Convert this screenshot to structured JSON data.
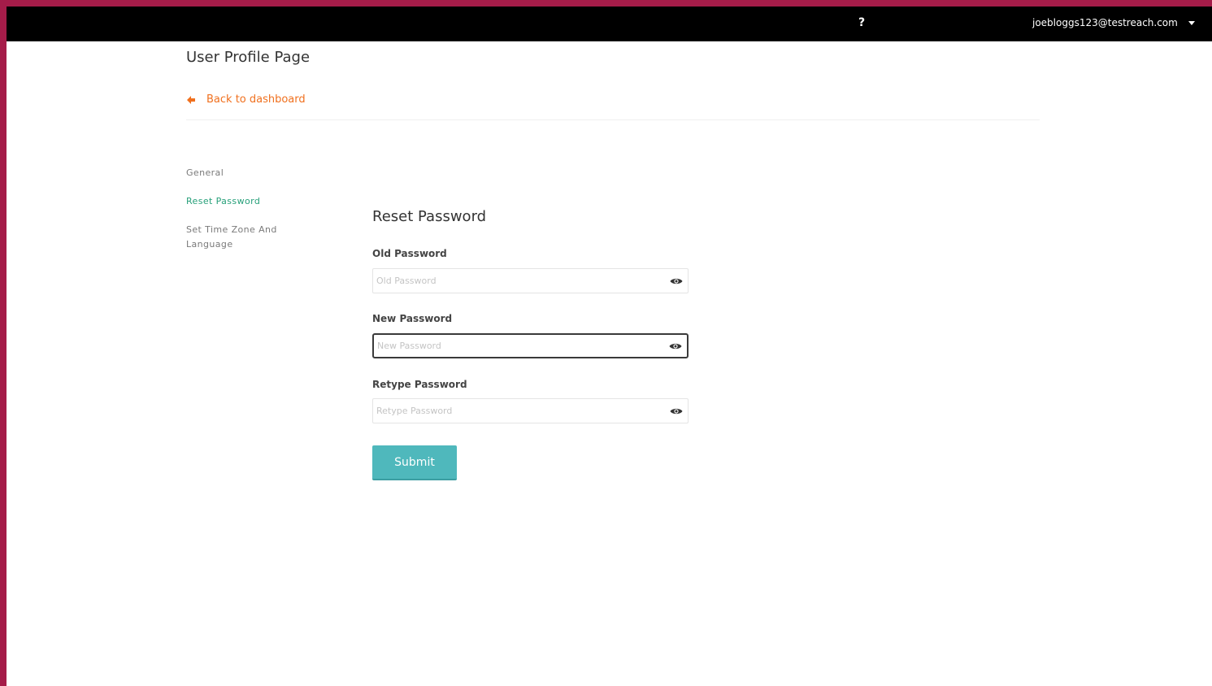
{
  "header": {
    "help_label": "?",
    "user_email": "joebloggs123@testreach.com"
  },
  "page": {
    "title": "User Profile Page",
    "back_label": "Back to dashboard"
  },
  "sidebar": {
    "items": [
      {
        "label": "General",
        "active": false
      },
      {
        "label": "Reset Password",
        "active": true
      },
      {
        "label": "Set Time Zone And Language",
        "active": false
      }
    ]
  },
  "form": {
    "title": "Reset Password",
    "fields": [
      {
        "label": "Old Password",
        "placeholder": "Old Password",
        "value": ""
      },
      {
        "label": "New Password",
        "placeholder": "New Password",
        "value": ""
      },
      {
        "label": "Retype Password",
        "placeholder": "Retype Password",
        "value": ""
      }
    ],
    "submit_label": "Submit"
  },
  "colors": {
    "frame_border": "#a51c49",
    "topbar": "#000000",
    "link_orange": "#f0701e",
    "active_nav_green": "#27a07a",
    "submit_teal": "#4fb8bc"
  },
  "icons": {
    "help": "question-mark-icon",
    "user_menu": "caret-down-icon",
    "back": "arrow-left-icon",
    "password_toggle": "eye-icon"
  }
}
